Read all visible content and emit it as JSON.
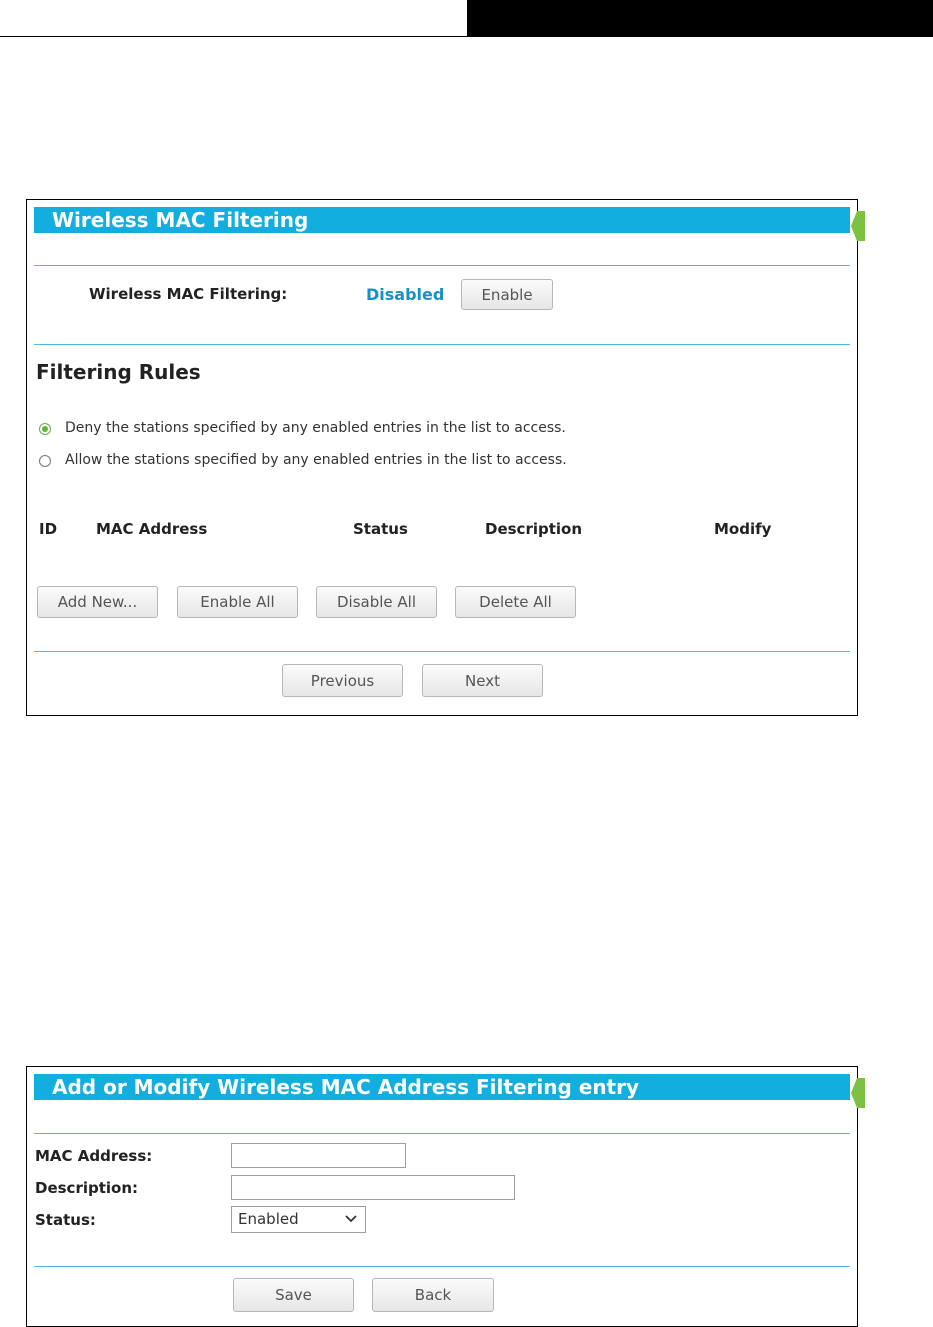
{
  "colors": {
    "title_bar": "#12aee0",
    "accent_text": "#1a8fc7",
    "divider": "#4fb6dc",
    "radio_selected": "#5fb831"
  },
  "filter_panel": {
    "title": "Wireless MAC Filtering",
    "mac_filter_label": "Wireless MAC Filtering:",
    "mac_filter_status": "Disabled",
    "enable_button": "Enable",
    "rules_heading": "Filtering Rules",
    "rule_options": [
      {
        "label": "Deny the stations specified by any enabled entries in the list to access.",
        "selected": true
      },
      {
        "label": "Allow the stations specified by any enabled entries in the list to access.",
        "selected": false
      }
    ],
    "table_headers": {
      "id": "ID",
      "mac": "MAC Address",
      "status": "Status",
      "description": "Description",
      "modify": "Modify"
    },
    "buttons": {
      "add_new": "Add New...",
      "enable_all": "Enable All",
      "disable_all": "Disable All",
      "delete_all": "Delete All"
    },
    "pager": {
      "previous": "Previous",
      "next": "Next"
    }
  },
  "entry_panel": {
    "title": "Add or Modify Wireless MAC Address Filtering entry",
    "mac_label": "MAC Address:",
    "mac_value": "",
    "description_label": "Description:",
    "description_value": "",
    "status_label": "Status:",
    "status_value": "Enabled",
    "buttons": {
      "save": "Save",
      "back": "Back"
    }
  }
}
